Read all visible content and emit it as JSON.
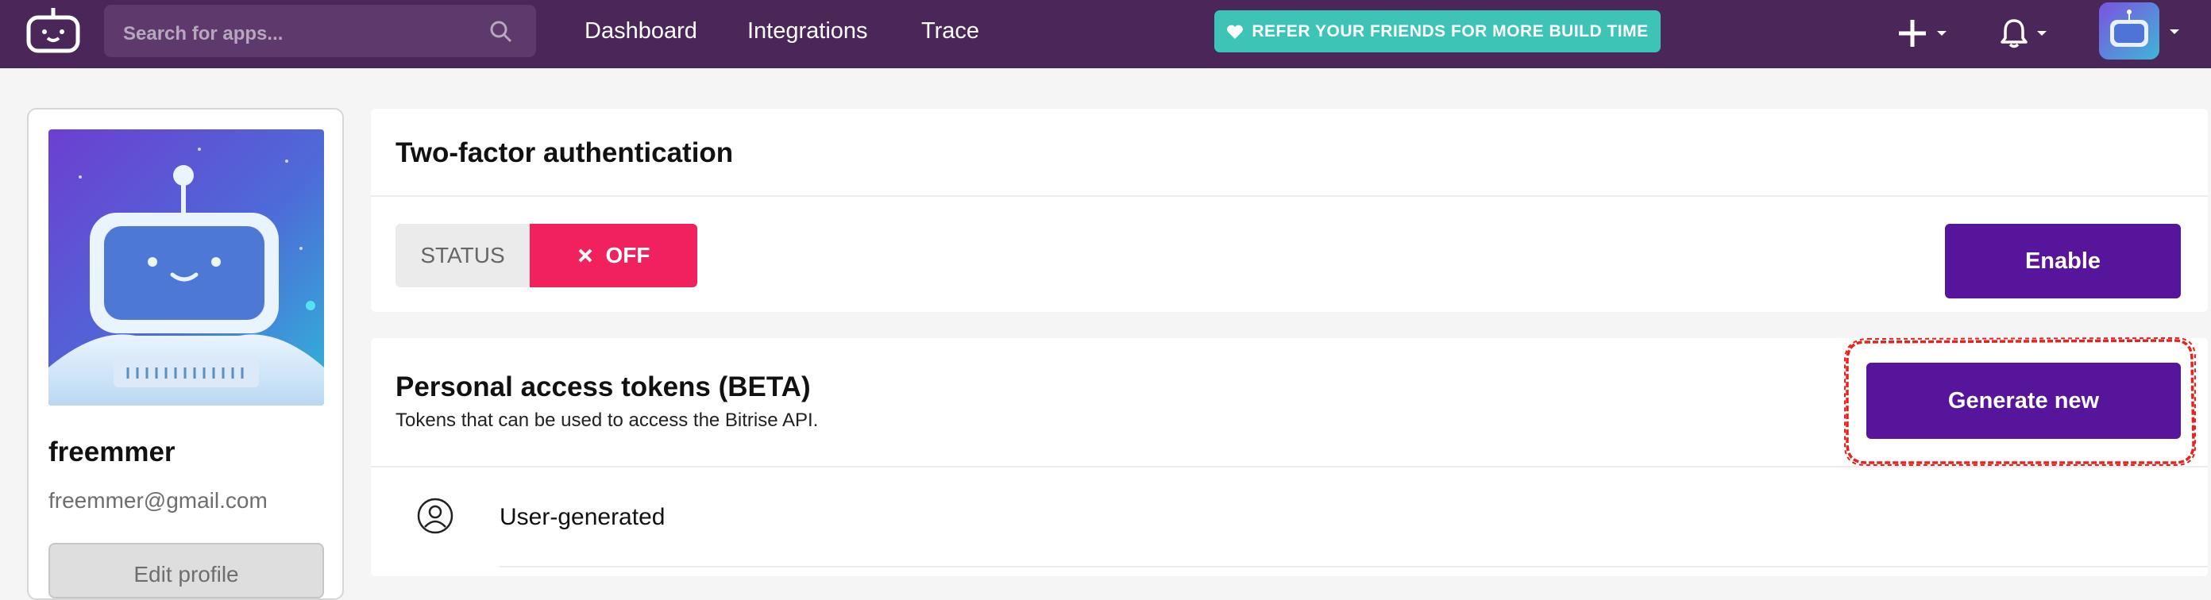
{
  "nav": {
    "search_placeholder": "Search for apps...",
    "links": [
      "Dashboard",
      "Integrations",
      "Trace"
    ],
    "refer_banner": "REFER YOUR FRIENDS FOR MORE BUILD TIME",
    "add_icon": "plus-icon",
    "notifications_icon": "bell-icon",
    "colors": {
      "bar": "#4a2758",
      "banner": "#3ec4b6"
    }
  },
  "profile": {
    "username": "freemmer",
    "email": "freemmer@gmail.com",
    "edit_label": "Edit profile"
  },
  "two_factor": {
    "title": "Two-factor authentication",
    "status_label": "STATUS",
    "status_value": "OFF",
    "enable_label": "Enable",
    "colors": {
      "off": "#f0215d",
      "button": "#56159a"
    }
  },
  "tokens": {
    "title": "Personal access tokens (BETA)",
    "subtitle": "Tokens that can be used to access the Bitrise API.",
    "generate_label": "Generate new",
    "section_label": "User-generated"
  }
}
